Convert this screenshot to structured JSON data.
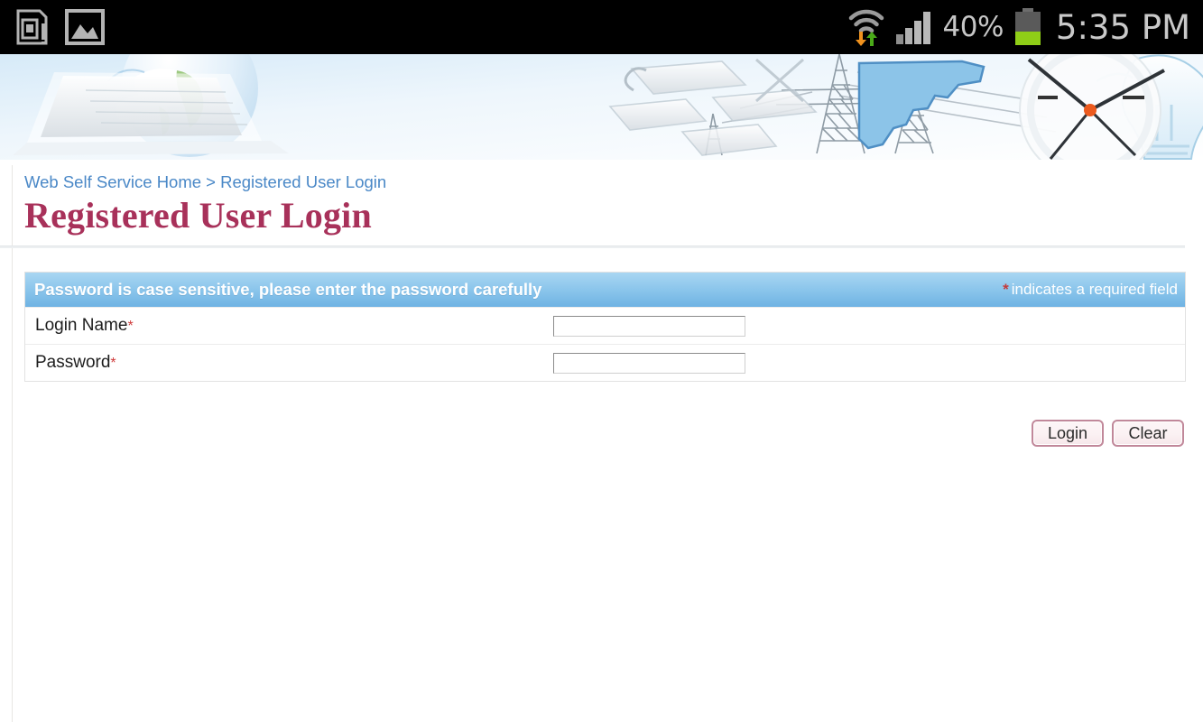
{
  "statusbar": {
    "left_icons": [
      {
        "name": "sim-card-icon"
      },
      {
        "name": "gallery-image-icon"
      }
    ],
    "wifi_icon": "wifi-transfer-icon",
    "signal_icon": "cellular-signal-icon",
    "battery_percent": "40%",
    "battery_icon": "battery-icon",
    "clock": "5:35 PM",
    "colors": {
      "background": "#000000",
      "text": "#c6c6c6",
      "battery_fill": "#8fce17",
      "download_arrow": "#f0921e",
      "upload_arrow": "#4aaa19"
    }
  },
  "banner": {
    "name": "utility-services-banner",
    "elements": [
      "laptop",
      "globe-with-clouds",
      "power-transmission-towers",
      "light-bulb",
      "keyboard-keys",
      "state-map-outline",
      "wall-clock"
    ]
  },
  "breadcrumb": {
    "text": "Web Self Service Home > Registered User Login",
    "home_label": "Web Self Service Home",
    "separator": ">",
    "current_label": "Registered User Login",
    "color": "#4a88c7"
  },
  "page": {
    "title": "Registered User Login",
    "title_color": "#a8315a"
  },
  "form": {
    "header_message": "Password is case sensitive, please enter the password carefully",
    "required_note_star": "*",
    "required_note": "indicates a required field",
    "header_gradient_top": "#a9d6f2",
    "header_gradient_bottom": "#6fb3e3",
    "required_star_color": "#c43a3a",
    "fields": [
      {
        "label": "Login Name",
        "required_marker": "*",
        "value": "",
        "placeholder": "",
        "type": "text"
      },
      {
        "label": "Password",
        "required_marker": "*",
        "value": "",
        "placeholder": "",
        "type": "password"
      }
    ],
    "buttons": [
      {
        "label": "Login",
        "name": "login-button"
      },
      {
        "label": "Clear",
        "name": "clear-button"
      }
    ],
    "button_border_color": "#c1889a"
  }
}
